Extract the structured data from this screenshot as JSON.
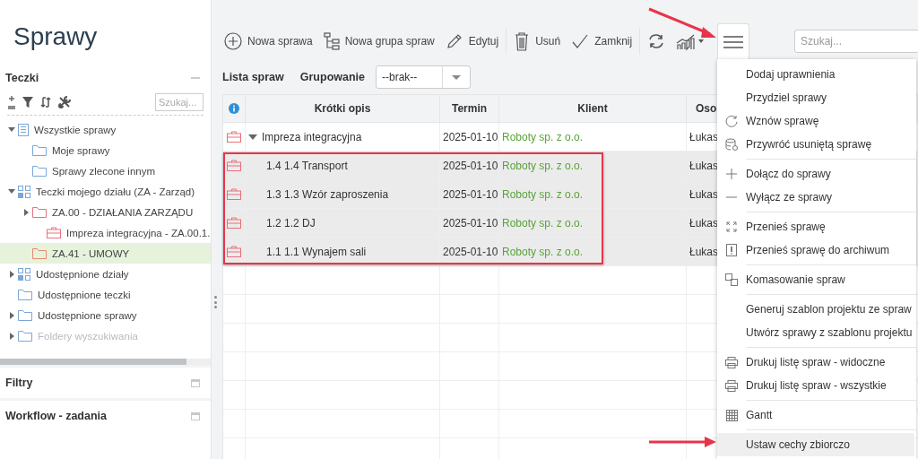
{
  "sidebar": {
    "title": "Sprawy",
    "folders_panel": {
      "title": "Teczki",
      "search": {
        "placeholder": "Szukaj..."
      },
      "tree": [
        {
          "label": "Wszystkie sprawy",
          "kind": "list",
          "color": "#7aa7d9",
          "expanded": true,
          "selected": false,
          "disabled": false,
          "children": [
            {
              "label": "Moje sprawy",
              "kind": "folder",
              "color": "#7aa7d9",
              "selected": false,
              "disabled": false
            },
            {
              "label": "Sprawy zlecone innym",
              "kind": "folder",
              "color": "#7aa7d9",
              "selected": false,
              "disabled": false
            }
          ]
        },
        {
          "label": "Teczki mojego działu (ZA - Zarząd)",
          "kind": "department",
          "color": "#7aa7d9",
          "expanded": true,
          "selected": false,
          "disabled": false,
          "children": [
            {
              "label": "ZA.00 - DZIAŁANIA ZARZĄDU",
              "kind": "folder",
              "color": "#e8707a",
              "expanded": false,
              "selected": false,
              "disabled": false,
              "children": [
                {
                  "label": "Impreza integracyjna - ZA.00.1.",
                  "kind": "case",
                  "color": "#e8707a",
                  "selected": false,
                  "disabled": false
                }
              ]
            },
            {
              "label": "ZA.41 - UMOWY",
              "kind": "folder",
              "color": "#e88a6a",
              "selected": true,
              "disabled": false
            }
          ]
        },
        {
          "label": "Udostępnione działy",
          "kind": "department",
          "color": "#7aa7d9",
          "expanded": false,
          "selected": false,
          "disabled": false
        },
        {
          "label": "Udostępnione teczki",
          "kind": "folder",
          "color": "#7aa7d9",
          "selected": false,
          "disabled": false
        },
        {
          "label": "Udostępnione sprawy",
          "kind": "folder",
          "color": "#7aa7d9",
          "expanded": false,
          "selected": false,
          "disabled": false
        },
        {
          "label": "Foldery wyszukiwania",
          "kind": "folder",
          "color": "#7aa7d9",
          "expanded": false,
          "selected": false,
          "disabled": true
        }
      ]
    },
    "panels": [
      {
        "title": "Filtry"
      },
      {
        "title": "Workflow - zadania"
      }
    ]
  },
  "toolbar": {
    "buttons": [
      {
        "label": "Nowa sprawa"
      },
      {
        "label": "Nowa grupa spraw"
      },
      {
        "label": "Edytuj"
      },
      {
        "label": "Usuń"
      },
      {
        "label": "Zamknij"
      }
    ],
    "menu_open": true,
    "search": {
      "placeholder": "Szukaj..."
    }
  },
  "list": {
    "title": "Lista spraw",
    "grouping": {
      "label": "Grupowanie",
      "value": "--brak--"
    }
  },
  "table": {
    "columns": [
      "Krótki opis",
      "Termin",
      "Klient",
      "Oso"
    ],
    "rows": [
      {
        "kind": "group",
        "expanded": true,
        "selected": false,
        "description": "Impreza integracyjna",
        "date": "2025-01-10",
        "client": "Roboty sp. z o.o.",
        "person": "Łukas"
      },
      {
        "kind": "case",
        "selected": true,
        "description": "1.4 1.4 Transport",
        "date": "2025-01-10",
        "client": "Roboty sp. z o.o.",
        "person": "Łukas"
      },
      {
        "kind": "case",
        "selected": true,
        "description": "1.3 1.3 Wzór zaproszenia",
        "date": "2025-01-10",
        "client": "Roboty sp. z o.o.",
        "person": "Łukas"
      },
      {
        "kind": "case",
        "selected": true,
        "description": "1.2 1.2 DJ",
        "date": "2025-01-10",
        "client": "Roboty sp. z o.o.",
        "person": "Łukas"
      },
      {
        "kind": "case",
        "selected": true,
        "description": "1.1 1.1 Wynajem sali",
        "date": "2025-01-10",
        "client": "Roboty sp. z o.o.",
        "person": "Łukas"
      }
    ]
  },
  "menu": {
    "groups": [
      [
        {
          "label": "Dodaj uprawnienia",
          "selected": false
        },
        {
          "label": "Przydziel sprawy",
          "selected": false
        },
        {
          "label": "Wznów sprawę",
          "selected": false
        },
        {
          "label": "Przywróć usuniętą sprawę",
          "selected": false
        }
      ],
      [
        {
          "label": "Dołącz do sprawy",
          "selected": false
        },
        {
          "label": "Wyłącz ze sprawy",
          "selected": false
        }
      ],
      [
        {
          "label": "Przenieś sprawę",
          "selected": false
        },
        {
          "label": "Przenieś sprawę do archiwum",
          "selected": false
        }
      ],
      [
        {
          "label": "Komasowanie spraw",
          "selected": false
        }
      ],
      [
        {
          "label": "Generuj szablon projektu ze spraw",
          "selected": false
        },
        {
          "label": "Utwórz sprawy z szablonu projektu",
          "selected": false
        }
      ],
      [
        {
          "label": "Drukuj listę spraw - widoczne",
          "selected": false
        },
        {
          "label": "Drukuj listę spraw - wszystkie",
          "selected": false
        }
      ],
      [
        {
          "label": "Gantt",
          "selected": false
        }
      ],
      [
        {
          "label": "Ustaw cechy zbiorczo",
          "selected": true
        }
      ]
    ]
  },
  "annotations": [
    {
      "kind": "arrow"
    },
    {
      "kind": "arrow"
    },
    {
      "kind": "highlight_box"
    }
  ]
}
